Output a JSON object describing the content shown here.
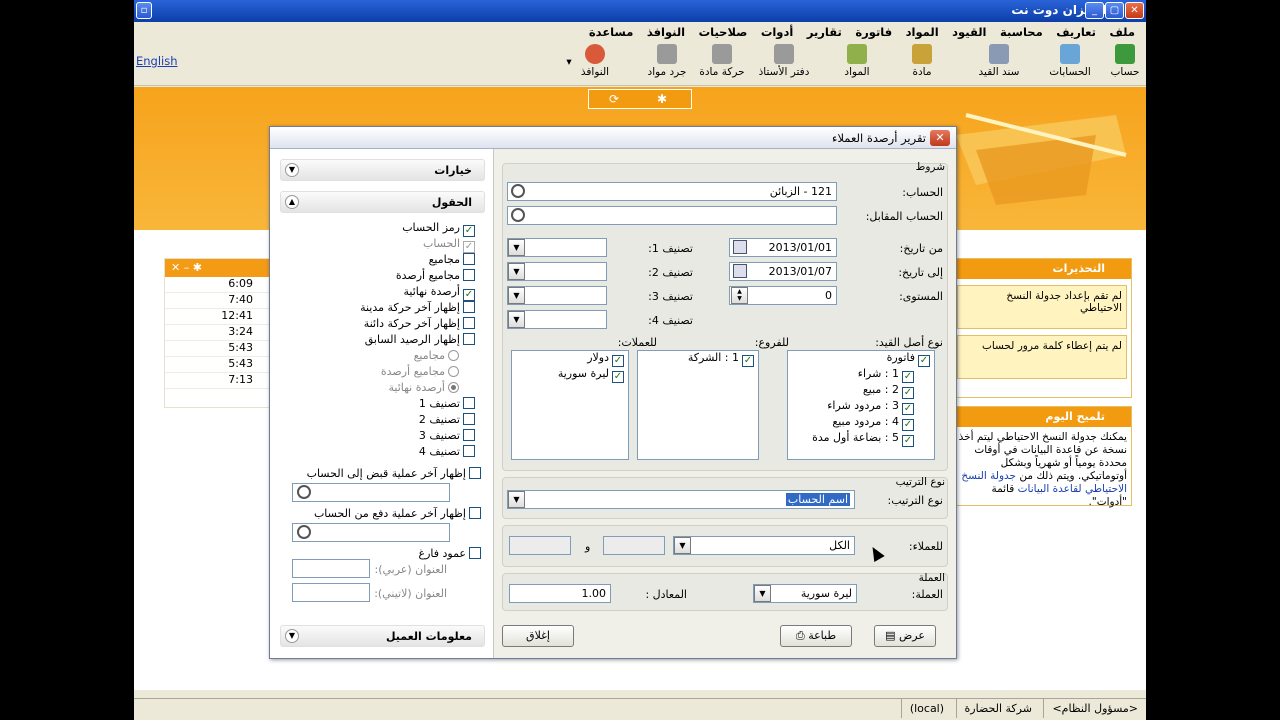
{
  "app": {
    "title": "الميزان دوت نت",
    "english_link": "English"
  },
  "menu": [
    "ملف",
    "تعاريف",
    "محاسبة",
    "القيود",
    "المواد",
    "فاتورة",
    "تقارير",
    "أدوات",
    "صلاحيات",
    "النوافذ",
    "مساعدة"
  ],
  "toolbar": {
    "items": [
      {
        "label": "حساب",
        "icon": "account-icon"
      },
      {
        "label": "الحسابات",
        "icon": "accounts-icon"
      },
      {
        "label": "سند القيد",
        "icon": "journal-voucher-icon"
      },
      {
        "label": "مادة",
        "icon": "material-icon"
      },
      {
        "label": "المواد",
        "icon": "materials-icon"
      },
      {
        "label": "دفتر الأستاذ",
        "icon": "ledger-icon"
      },
      {
        "label": "حركة مادة",
        "icon": "material-movement-icon"
      },
      {
        "label": "جرد مواد",
        "icon": "inventory-icon"
      },
      {
        "label": "النوافذ",
        "icon": "windows-icon"
      }
    ]
  },
  "left_panel": {
    "times": [
      "6:09",
      "7:40",
      "12:41",
      "3:24",
      "5:43",
      "5:43",
      "7:13"
    ]
  },
  "right_panel": {
    "alerts_title": "التحذيرات",
    "alerts": [
      "لم تقم بإعداد جدولة النسخ الاحتياطي",
      "لم يتم إعطاء كلمة مرور لحساب"
    ],
    "tip_title": "تلميح اليوم",
    "tip_text": "يمكنك جدولة النسخ الاحتياطي ليتم أخذ نسخة عن قاعدة البيانات في أوقات محددة يومياً أو شهرياً وبشكل أوتوماتيكي. ويتم ذلك من",
    "tip_link": "جدولة النسخ الاحتياطي لقاعدة البيانات",
    "tip_tail": "قائمة \"أدوات\"."
  },
  "status": {
    "user": "<مسؤول النظام>",
    "company": "شركة الحضارة",
    "server": "(local)"
  },
  "dialog": {
    "title": "تقرير أرصدة العملاء",
    "sections": {
      "options": "خيارات",
      "fields": "الحقول",
      "customer_info": "معلومات العميل"
    },
    "fields": [
      {
        "label": "رمز الحساب",
        "checked": true
      },
      {
        "label": "الحساب",
        "checked": true,
        "disabled": true
      },
      {
        "label": "مجاميع",
        "checked": false
      },
      {
        "label": "مجاميع أرصدة",
        "checked": false
      },
      {
        "label": "أرصدة نهائية",
        "checked": true
      },
      {
        "label": "إظهار آخر حركة مدينة",
        "checked": false
      },
      {
        "label": "إظهار آخر حركة دائنة",
        "checked": false
      },
      {
        "label": "إظهار الرصيد السابق",
        "checked": false
      }
    ],
    "radios": [
      {
        "label": "مجاميع",
        "on": false
      },
      {
        "label": "مجاميع أرصدة",
        "on": false
      },
      {
        "label": "أرصدة نهائية",
        "on": true
      }
    ],
    "class_checks": [
      "تصنيف 1",
      "تصنيف 2",
      "تصنيف 3",
      "تصنيف 4"
    ],
    "last_receipt": "إظهار آخر عملية قبض إلى الحساب",
    "last_payment": "إظهار آخر عملية دفع من الحساب",
    "empty_column": "عمود فارغ",
    "address_ar": "العنوان (عربي):",
    "address_lat": "العنوان (لاتيني):",
    "conditions": "شروط",
    "account_label": "الحساب:",
    "account_value": "121 - الزبائن",
    "counter_account_label": "الحساب المقابل:",
    "from_date_label": "من تاريخ:",
    "from_date": "2013/01/01",
    "to_date_label": "إلى تاريخ:",
    "to_date": "2013/01/07",
    "level_label": "المستوى:",
    "level": "0",
    "class_labels": [
      "تصنيف 1:",
      "تصنيف 2:",
      "تصنيف 3:",
      "تصنيف 4:"
    ],
    "entry_origin_label": "نوع أصل القيد:",
    "branches_label": "للفروع:",
    "currencies_label": "للعملات:",
    "entry_origins": [
      "فاتورة",
      "1 : شراء",
      "2 : مبيع",
      "3 : مردود شراء",
      "4 : مردود مبيع",
      "5 : بضاعة أول مدة"
    ],
    "branches": [
      "1 : الشركة"
    ],
    "currencies": [
      "دولار",
      "ليرة سورية"
    ],
    "sort_group": "نوع الترتيب",
    "sort_label": "نوع الترتيب:",
    "sort_value": "اسم الحساب",
    "customers_label": "للعملاء:",
    "customers_value": "الكل",
    "and": "و",
    "currency_group": "العملة",
    "currency_label": "العملة:",
    "currency_value": "ليرة سورية",
    "rate_label": "المعادل :",
    "rate_value": "1.00",
    "btn_show": "عرض",
    "btn_print": "طباعة",
    "btn_close": "إغلاق"
  }
}
